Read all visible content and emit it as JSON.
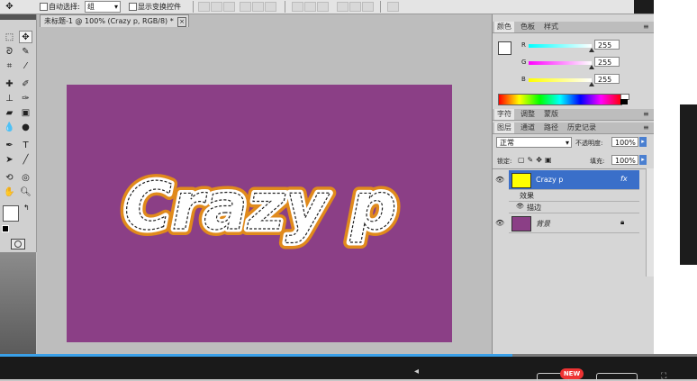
{
  "options_bar": {
    "auto_select_label": "自动选择:",
    "auto_select_value": "组",
    "show_transform_label": "显示变换控件"
  },
  "document": {
    "tab_title": "未标题-1 @ 100% (Crazy p, RGB/8) *",
    "canvas_color": "#8b3f86",
    "text_layer_content": "Crazy p",
    "text_fill": "#ffffff",
    "stroke_color": "#e08a1c"
  },
  "panels": {
    "color_tabs": [
      "颜色",
      "色板",
      "样式"
    ],
    "sliders": [
      {
        "label": "R",
        "value": "255",
        "fraction": 1.0
      },
      {
        "label": "G",
        "value": "255",
        "fraction": 1.0
      },
      {
        "label": "B",
        "value": "255",
        "fraction": 1.0
      }
    ],
    "char_tabs": [
      "字符",
      "调整",
      "蒙版"
    ],
    "layer_tabs": [
      "图层",
      "通道",
      "路径",
      "历史记录"
    ],
    "blend_mode": "正常",
    "opacity_label": "不透明度:",
    "opacity_value": "100%",
    "lock_label": "锁定:",
    "fill_label": "填充:",
    "fill_value": "100%",
    "layers": {
      "text_layer_name": "Crazy p",
      "effects_label": "效果",
      "stroke_effect_label": "描边",
      "background_layer_name": "背景",
      "fx_label": "fx"
    }
  },
  "player": {
    "progress": 0.735,
    "badge": "NEW"
  }
}
